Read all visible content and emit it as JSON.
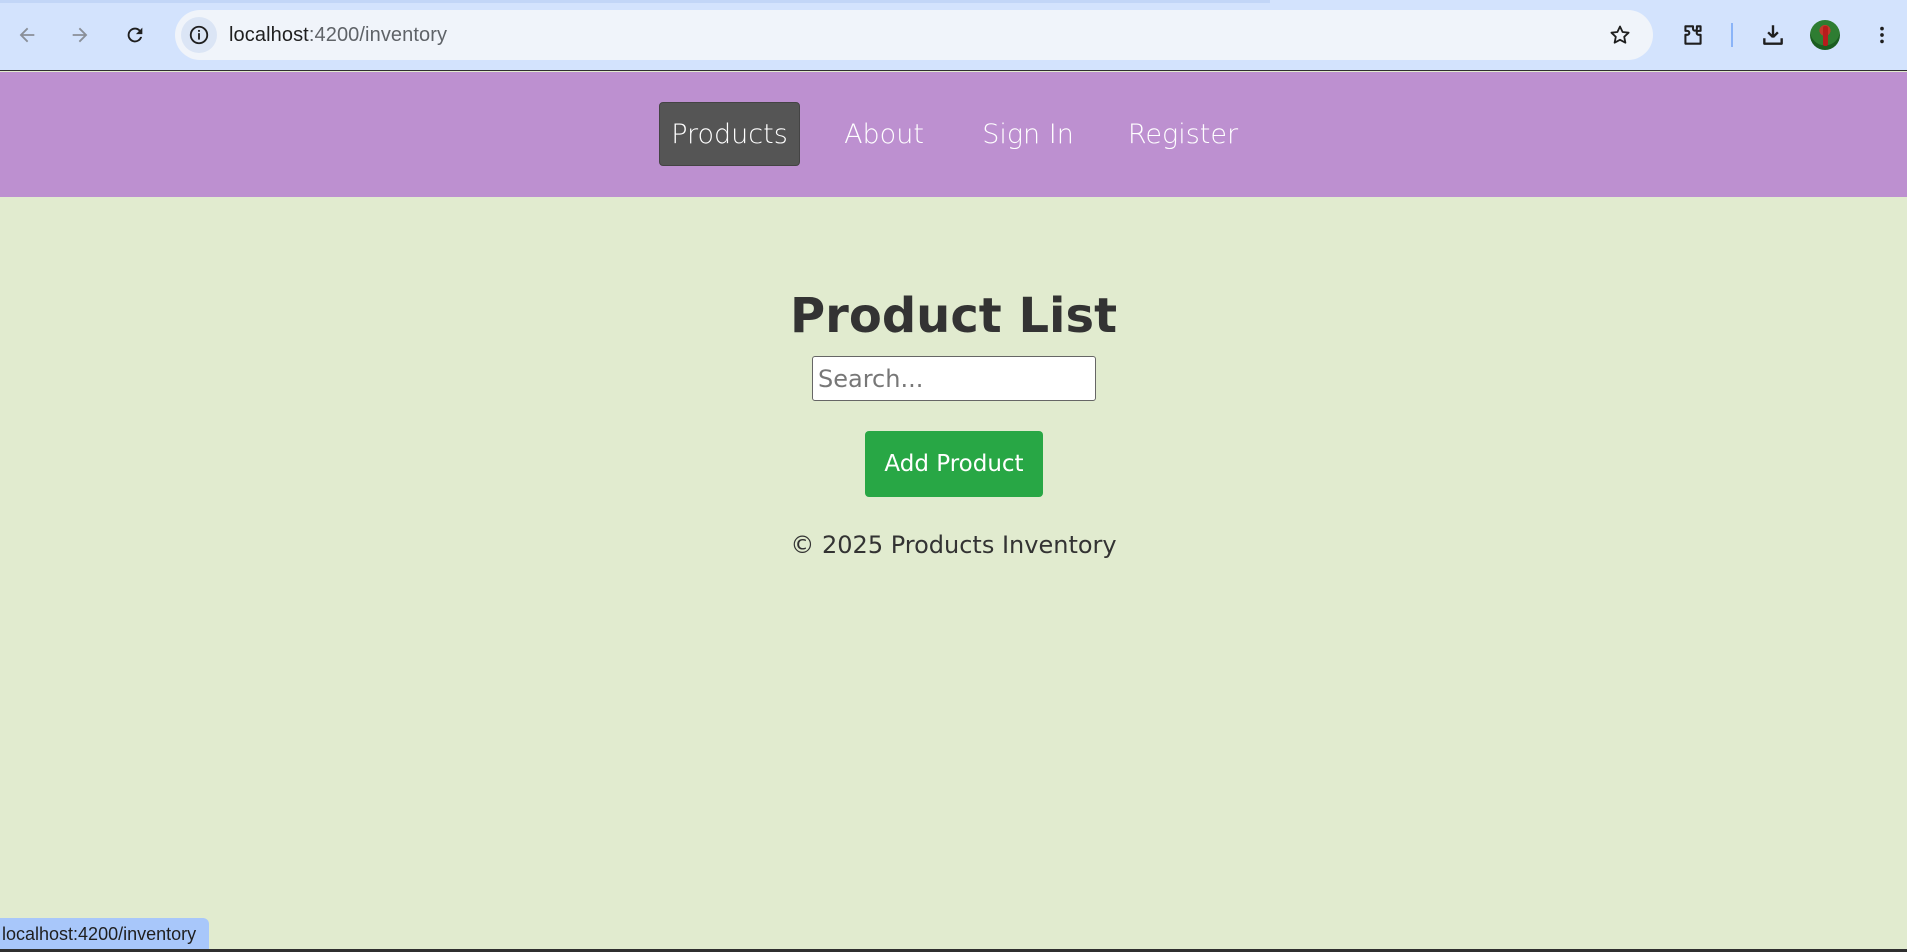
{
  "browser": {
    "url_host": "localhost",
    "url_path": ":4200/inventory",
    "status_text": "localhost:4200/inventory",
    "icons": {
      "back": "arrow-left-icon",
      "forward": "arrow-right-icon",
      "reload": "reload-icon",
      "site_info": "info-icon",
      "bookmark": "star-icon",
      "extensions": "puzzle-icon",
      "downloads": "download-icon",
      "menu": "kebab-menu-icon"
    }
  },
  "navbar": {
    "background": "#bd90d0",
    "items": [
      {
        "label": "Products",
        "active": true
      },
      {
        "label": "About",
        "active": false
      },
      {
        "label": "Sign In",
        "active": false
      },
      {
        "label": "Register",
        "active": false
      }
    ]
  },
  "main": {
    "title": "Product List",
    "search_placeholder": "Search...",
    "add_button_label": "Add Product",
    "add_button_color": "#28a745",
    "background": "#e1ebcf"
  },
  "footer": {
    "text": "© 2025 Products Inventory"
  }
}
